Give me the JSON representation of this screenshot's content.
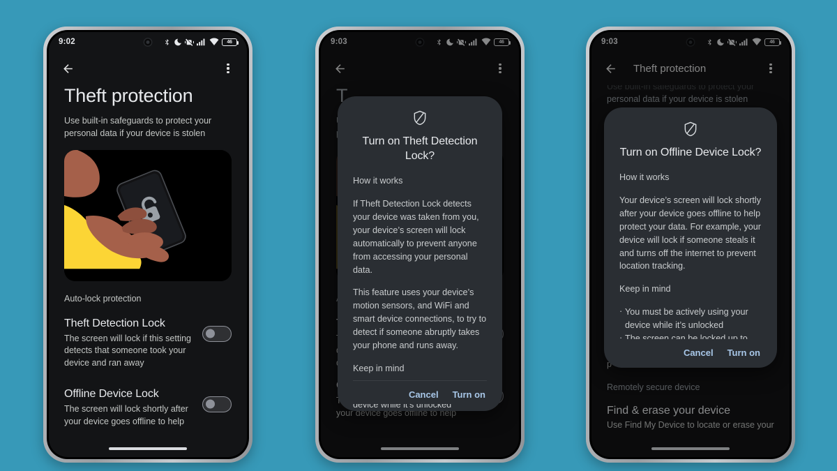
{
  "background_color": "#3799b8",
  "accent_color": "#a8c7e8",
  "phones": [
    {
      "id": "phone-1",
      "status_bar": {
        "time": "9:02",
        "battery_level": "46",
        "icons": [
          "bluetooth-icon",
          "do-not-disturb-moon-icon",
          "vibrate-off-icon",
          "cellular-signal-icon",
          "wifi-icon",
          "battery-icon"
        ]
      },
      "app_bar": {
        "back_label": "back-arrow-icon",
        "title": "",
        "overflow_label": "more-options-icon"
      },
      "page": {
        "title": "Theft protection",
        "subtitle": "Use built-in safeguards to protect your personal data if your device is stolen",
        "illustration": "person-holding-phone-with-unlocked-padlock",
        "section_label": "Auto-lock protection",
        "settings": [
          {
            "title": "Theft Detection Lock",
            "description": "The screen will lock if this setting detects that someone took your device and ran away",
            "toggle_state": "off"
          },
          {
            "title": "Offline Device Lock",
            "description": "The screen will lock shortly after your device goes offline to help",
            "toggle_state": "off"
          }
        ]
      }
    },
    {
      "id": "phone-2",
      "status_bar": {
        "time": "9:03",
        "battery_level": "46",
        "icons": [
          "bluetooth-icon",
          "do-not-disturb-moon-icon",
          "vibrate-off-icon",
          "cellular-signal-icon",
          "wifi-icon",
          "battery-icon"
        ]
      },
      "app_bar": {
        "back_label": "back-arrow-icon",
        "title": "",
        "overflow_label": "more-options-icon"
      },
      "background_page": {
        "title_fragment": "T",
        "subtitle_fragment_1": "U",
        "subtitle_fragment_2": "p",
        "section_label_fragment": "A",
        "setting1_fragment": "T",
        "setting1_desc_fragments": [
          "T",
          "d",
          "d"
        ],
        "setting2_title": "Offline Device Lock",
        "setting2_desc": "The screen will lock shortly after your device goes offline to help"
      },
      "dialog": {
        "icon": "shield-slash-icon",
        "title": "Turn on Theft Detection Lock?",
        "sections": [
          {
            "heading": "How it works",
            "paragraphs": [
              "If Theft Detection Lock detects your device was taken from you, your device’s screen will lock automatically to prevent anyone from accessing your personal data.",
              "This feature uses your device’s motion sensors, and WiFi and smart device connections, to try to detect if someone abruptly takes your phone and runs away."
            ]
          },
          {
            "heading": "Keep in mind",
            "paragraphs": [
              "You must be actively using your device while it’s unlocked"
            ]
          }
        ],
        "cancel_label": "Cancel",
        "confirm_label": "Turn on"
      }
    },
    {
      "id": "phone-3",
      "status_bar": {
        "time": "9:03",
        "battery_level": "46",
        "icons": [
          "bluetooth-icon",
          "do-not-disturb-moon-icon",
          "vibrate-off-icon",
          "cellular-signal-icon",
          "wifi-icon",
          "battery-icon"
        ]
      },
      "app_bar": {
        "back_label": "back-arrow-icon",
        "title": "Theft protection",
        "overflow_label": "more-options-icon"
      },
      "background_page": {
        "subtitle_clipped": "Use built-in safeguards to protect your",
        "subtitle_line2": "personal data if your device is stolen",
        "section_label_fragment": "A",
        "setting1_fragment": "T",
        "setting1_desc_fragments": [
          "T",
          "d",
          "d"
        ],
        "setting2_fragment": "O",
        "setting2_desc_fragments": [
          "T",
          "y",
          "p"
        ],
        "footer_label": "Remotely secure device",
        "footer_title": "Find & erase your device",
        "footer_desc": "Use Find My Device to locate or erase your"
      },
      "dialog": {
        "icon": "shield-slash-icon",
        "title": "Turn on Offline Device Lock?",
        "sections": [
          {
            "heading": "How it works",
            "paragraphs": [
              "Your device’s screen will lock shortly after your device goes offline to help protect your data. For example, your device will lock if someone steals it and turns off the internet to prevent location tracking."
            ]
          },
          {
            "heading": "Keep in mind",
            "bullets": [
              "You must be actively using your device while it’s unlocked",
              "The screen can be locked up to twice a day"
            ]
          }
        ],
        "cancel_label": "Cancel",
        "confirm_label": "Turn on"
      }
    }
  ]
}
